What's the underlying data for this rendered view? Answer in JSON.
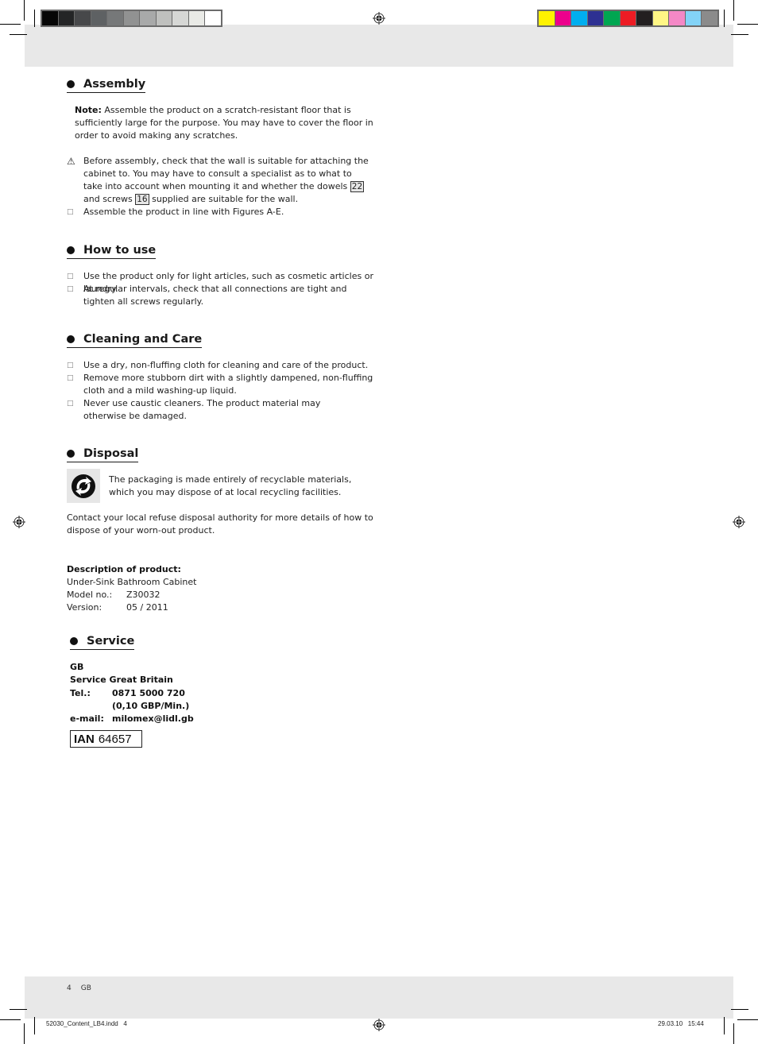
{
  "print_marks": {
    "gray_swatches": [
      "#060606",
      "#242526",
      "#47484a",
      "#5e6163",
      "#767879",
      "#919292",
      "#a8a9a9",
      "#bfc0be",
      "#d6d7d5",
      "#e9eae6",
      "#ffffff"
    ],
    "color_swatches": [
      "#fff200",
      "#ec008c",
      "#00aeef",
      "#2e3192",
      "#00a651",
      "#ed1c24",
      "#231f20",
      "#fff685",
      "#f488c6",
      "#83d3f7",
      "#8b8b8b"
    ]
  },
  "assembly": {
    "heading": "Assembly",
    "note_label": "Note:",
    "note_text": " Assemble the product on a scratch-resistant floor that is sufficiently large for the purpose. You may have to cover the floor in order to avoid making any scratches.",
    "warning": {
      "icon": "warning-triangle-icon",
      "text_before": "Before assembly, check that the wall is suitable for attaching the cabinet to. You may have to consult a specialist as to what to take into account when mounting it and whether the dowels ",
      "ref1": "22",
      "text_mid": " and screws ",
      "ref2": "16",
      "text_after": " supplied are suitable for the wall."
    },
    "items": [
      "Assemble the product in line with Figures A-E."
    ]
  },
  "how_to_use": {
    "heading": "How to use",
    "items": [
      "Use the product only for light articles, such as cosmetic articles or laundry.",
      "At regular intervals, check that all connections are tight and tighten all screws regularly."
    ]
  },
  "cleaning": {
    "heading": "Cleaning and Care",
    "items": [
      "Use a dry, non-fluffing cloth for cleaning and care of the product.",
      "Remove more stubborn dirt with a slightly dampened, non-fluffing cloth and a mild washing-up liquid.",
      "Never use caustic cleaners. The product material may otherwise be damaged."
    ]
  },
  "disposal": {
    "heading": "Disposal",
    "icon": "recycling-icon",
    "packaging_text": "The packaging is made entirely of recyclable materials, which you may dispose of at local recycling facilities.",
    "contact_text": "Contact your local refuse disposal authority for more details of how to dispose of your worn-out product."
  },
  "product": {
    "heading": "Description of product:",
    "name": "Under-Sink Bathroom Cabinet",
    "model_label": "Model no.:",
    "model_value": "Z30032",
    "version_label": "Version:",
    "version_value": "05 / 2011"
  },
  "service": {
    "heading": "Service",
    "country": "GB",
    "name": "Service Great Britain",
    "tel_label": "Tel.:",
    "tel_value": "0871 5000 720",
    "tel_rate": "(0,10 GBP/Min.)",
    "email_label": "e-mail:",
    "email_value": "milomex@lidl.gb",
    "ian_label": "IAN",
    "ian_value": "64657"
  },
  "footer": {
    "page_number": "4",
    "language": "GB",
    "file_slug": "52030_Content_LB4.indd   4",
    "date_slug": "29.03.10   15:44"
  }
}
